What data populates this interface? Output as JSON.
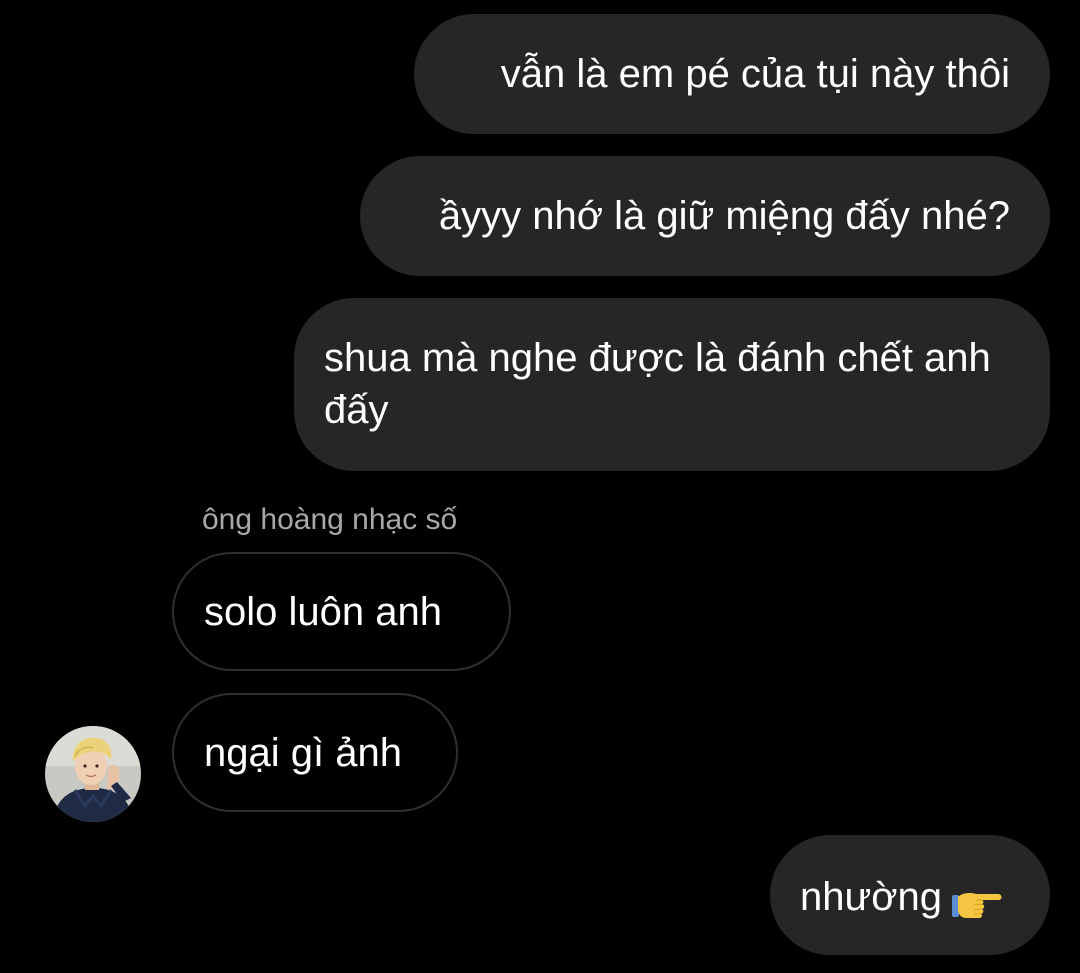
{
  "conversation": {
    "messages": [
      {
        "text": "vẫn là em pé của tụi này thôi",
        "direction": "outgoing"
      },
      {
        "text": "ầyyy nhớ là giữ miệng đấy nhé?",
        "direction": "outgoing"
      },
      {
        "text": "shua mà nghe được là đánh chết anh đấy",
        "direction": "outgoing"
      },
      {
        "text": "solo luôn anh",
        "direction": "incoming"
      },
      {
        "text": "ngại gì ảnh",
        "direction": "incoming"
      },
      {
        "text": "nhường",
        "direction": "outgoing",
        "emoji": "backhand-index-pointing-right-icon"
      }
    ],
    "incoming_sender": {
      "name": "ông hoàng nhạc số",
      "avatar": "contact-avatar-photo"
    }
  },
  "colors": {
    "background": "#000000",
    "outgoing_bubble": "#262626",
    "incoming_bubble_border": "#2f2f2f",
    "sender_name": "#a8a8a8",
    "text": "#ffffff"
  }
}
